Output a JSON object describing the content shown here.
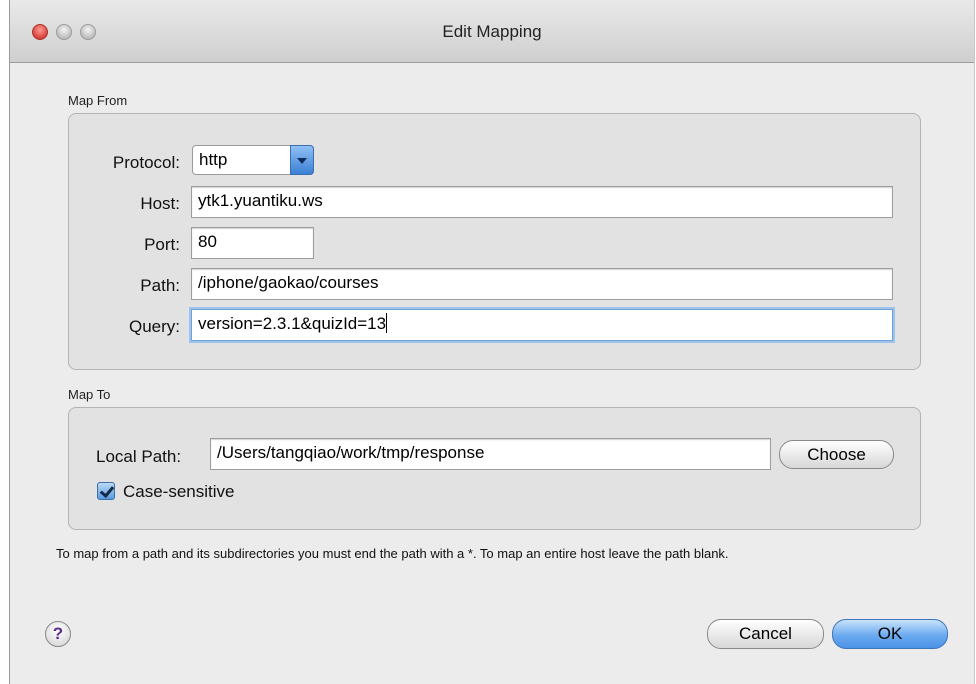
{
  "window": {
    "title": "Edit Mapping"
  },
  "map_from": {
    "label": "Map From",
    "protocol_label": "Protocol:",
    "protocol_value": "http",
    "host_label": "Host:",
    "host_value": "ytk1.yuantiku.ws",
    "port_label": "Port:",
    "port_value": "80",
    "path_label": "Path:",
    "path_value": "/iphone/gaokao/courses",
    "query_label": "Query:",
    "query_value": "version=2.3.1&quizId=13"
  },
  "map_to": {
    "label": "Map To",
    "local_path_label": "Local Path:",
    "local_path_value": "/Users/tangqiao/work/tmp/response",
    "choose_label": "Choose",
    "case_sensitive_label": "Case-sensitive",
    "case_sensitive_checked": true
  },
  "help_text": "To map from a path and its subdirectories you must end the path with a *. To map an entire host leave the path blank.",
  "buttons": {
    "help": "?",
    "cancel": "Cancel",
    "ok": "OK"
  },
  "colors": {
    "primary_button": "#5b9be6",
    "focus_ring": "#9ec3ee",
    "close_button": "#d8413a"
  }
}
